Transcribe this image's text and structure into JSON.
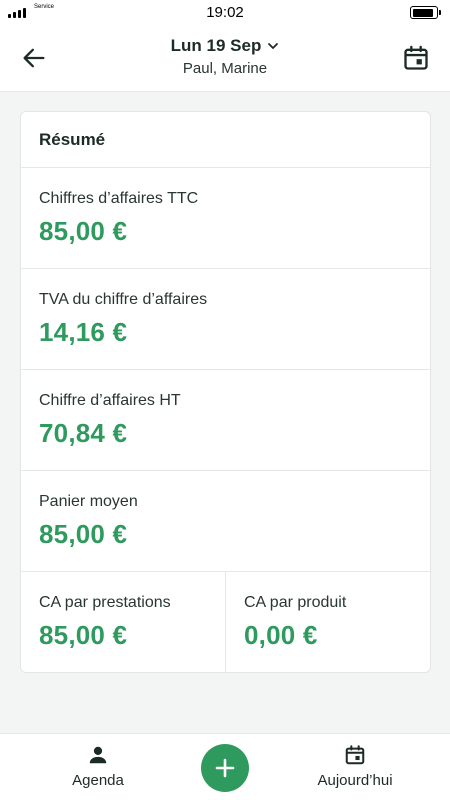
{
  "status_bar": {
    "carrier": "Service",
    "time": "19:02"
  },
  "header": {
    "date": "Lun 19 Sep",
    "subtitle": "Paul, Marine"
  },
  "summary": {
    "title": "Résumé",
    "stats": [
      {
        "label": "Chiffres d’affaires TTC",
        "value": "85,00 €"
      },
      {
        "label": "TVA du chiffre d’affaires",
        "value": "14,16 €"
      },
      {
        "label": "Chiffre d’affaires HT",
        "value": "70,84 €"
      },
      {
        "label": "Panier moyen",
        "value": "85,00 €"
      }
    ],
    "split": [
      {
        "label": "CA par prestations",
        "value": "85,00 €"
      },
      {
        "label": "CA par produit",
        "value": "0,00 €"
      }
    ]
  },
  "bottom_nav": {
    "agenda_label": "Agenda",
    "today_label": "Aujourd’hui"
  },
  "icons": {
    "back": "arrow-left-icon",
    "calendar": "calendar-icon",
    "dropdown": "chevron-down-icon",
    "agenda": "person-icon",
    "add": "plus-icon",
    "today": "calendar-icon"
  },
  "colors": {
    "accent": "#2e9a5e",
    "text": "#1d2b27",
    "background": "#f3f4f4"
  }
}
